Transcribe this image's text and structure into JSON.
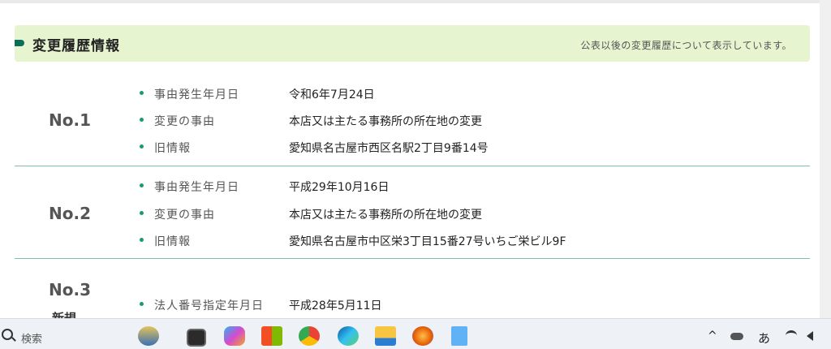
{
  "section": {
    "title": "変更履歴情報",
    "note": "公表以後の変更履歴について表示しています。"
  },
  "entries": [
    {
      "no": "No.1",
      "rows": [
        {
          "label": "事由発生年月日",
          "value": "令和6年7月24日"
        },
        {
          "label": "変更の事由",
          "value": "本店又は主たる事務所の所在地の変更"
        },
        {
          "label": "旧情報",
          "value": "愛知県名古屋市西区名駅2丁目9番14号"
        }
      ]
    },
    {
      "no": "No.2",
      "rows": [
        {
          "label": "事由発生年月日",
          "value": "平成29年10月16日"
        },
        {
          "label": "変更の事由",
          "value": "本店又は主たる事務所の所在地の変更"
        },
        {
          "label": "旧情報",
          "value": "愛知県名古屋市中区栄3丁目15番27号いちご栄ビル9F"
        }
      ]
    },
    {
      "no": "No.3",
      "sub": "新規",
      "rows": [
        {
          "label": "法人番号指定年月日",
          "value": "平成28年5月11日"
        }
      ]
    }
  ],
  "taskbar": {
    "search_label": "検索",
    "ime_label": "あ",
    "chevron": "^",
    "icons": [
      "pharaoh-icon",
      "terminal-icon",
      "copilot-icon",
      "store-icon",
      "chrome-icon",
      "edge-icon",
      "file-explorer-icon",
      "firefox-icon",
      "notepad-icon"
    ]
  },
  "colors": {
    "header_bg": "#e6f4d0",
    "accent": "#0b6e5a",
    "bullet": "#1a9a74",
    "divider": "#7fbfae"
  }
}
